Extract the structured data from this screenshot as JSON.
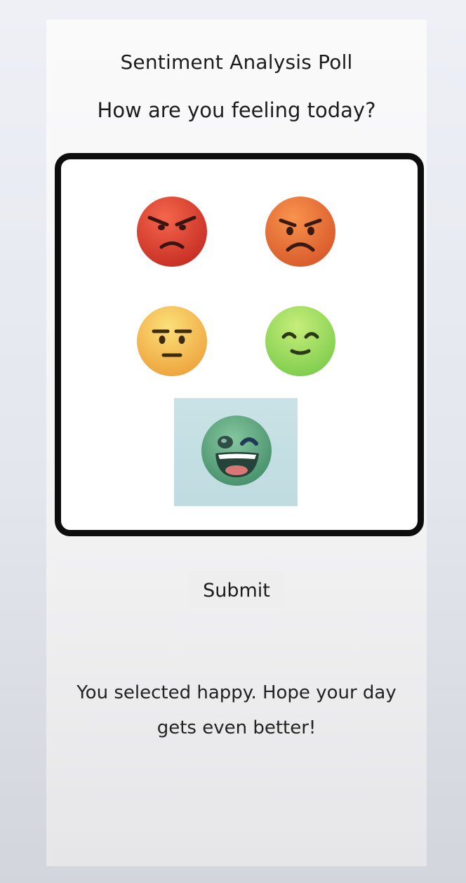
{
  "poll": {
    "title": "Sentiment Analysis Poll",
    "question": "How are you feeling today?",
    "options": [
      {
        "name": "angry",
        "color": "#e2432f"
      },
      {
        "name": "upset",
        "color": "#ef7a35"
      },
      {
        "name": "neutral",
        "color": "#f6c64a"
      },
      {
        "name": "content",
        "color": "#9edb5e"
      },
      {
        "name": "happy",
        "color": "#5faa84",
        "selected": true
      }
    ],
    "selection_highlight_color": "#c5e0e4",
    "submit_label": "Submit",
    "result_message": "You selected happy. Hope your day gets even better!"
  }
}
